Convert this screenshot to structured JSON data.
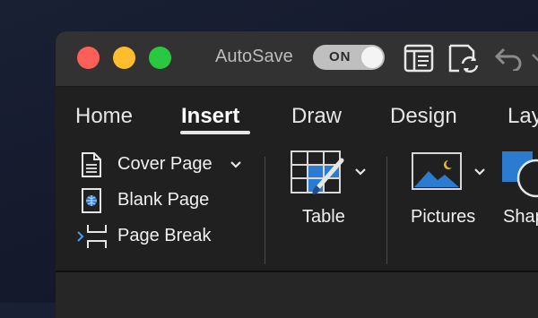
{
  "titlebar": {
    "autosave_label": "AutoSave",
    "autosave_state": "ON"
  },
  "tabs": [
    {
      "label": "Home"
    },
    {
      "label": "Insert"
    },
    {
      "label": "Draw"
    },
    {
      "label": "Design"
    },
    {
      "label": "Lay"
    }
  ],
  "pages_group": {
    "cover_page": "Cover Page",
    "blank_page": "Blank Page",
    "page_break": "Page Break"
  },
  "table_label": "Table",
  "pictures_label": "Pictures",
  "shapes_label": "Shap",
  "colors": {
    "accent_blue": "#2b7bd1",
    "red": "#fe5f57",
    "yellow": "#febc2e",
    "green": "#28c840"
  }
}
